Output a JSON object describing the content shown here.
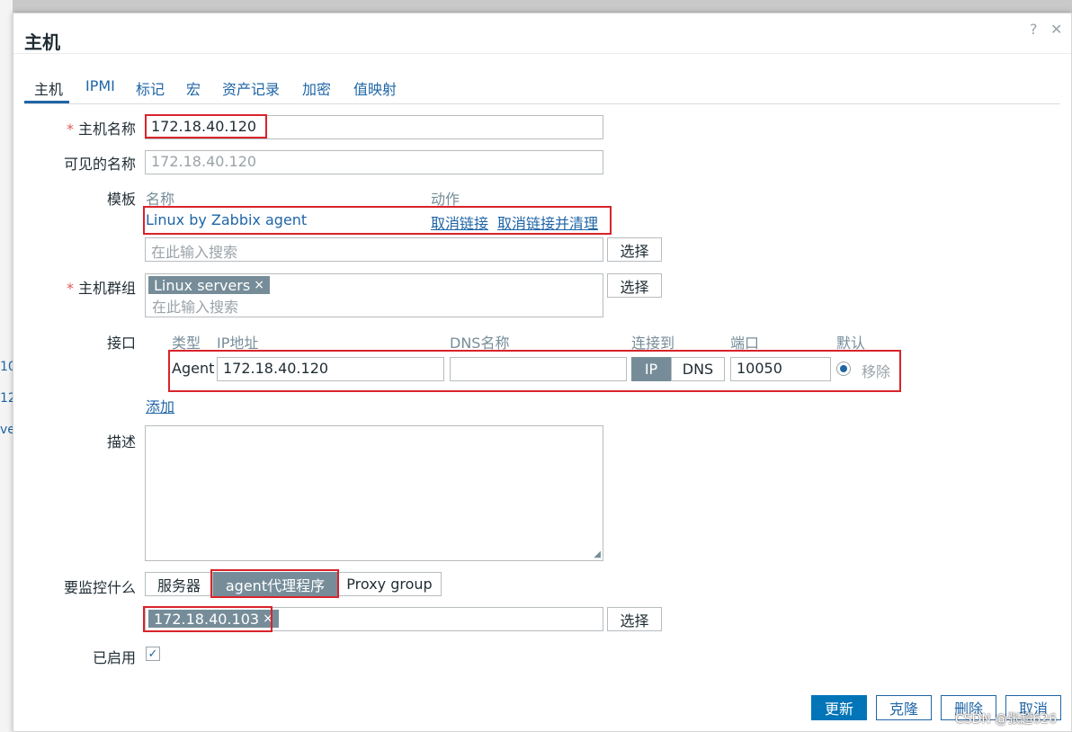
{
  "background": {
    "peek_lines": [
      "10",
      "12",
      "ve"
    ]
  },
  "dialog": {
    "title": "主机",
    "help_icon": "?",
    "close_icon": "✕"
  },
  "tabs": [
    {
      "label": "主机",
      "active": true
    },
    {
      "label": "IPMI",
      "active": false
    },
    {
      "label": "标记",
      "active": false
    },
    {
      "label": "宏",
      "active": false
    },
    {
      "label": "资产记录",
      "active": false
    },
    {
      "label": "加密",
      "active": false
    },
    {
      "label": "值映射",
      "active": false
    }
  ],
  "form": {
    "host_name": {
      "required_mark": "*",
      "label": "主机名称",
      "value": "172.18.40.120"
    },
    "visible_name": {
      "label": "可见的名称",
      "placeholder": "172.18.40.120"
    },
    "templates": {
      "label": "模板",
      "col_name": "名称",
      "col_action": "动作",
      "rows": [
        {
          "name": "Linux by Zabbix agent",
          "unlink": "取消链接",
          "unlink_clear": "取消链接并清理"
        }
      ],
      "search_placeholder": "在此输入搜索",
      "select_button": "选择"
    },
    "host_groups": {
      "required_mark": "*",
      "label": "主机群组",
      "tags": [
        {
          "text": "Linux servers",
          "remove": "×"
        }
      ],
      "search_placeholder": "在此输入搜索",
      "select_button": "选择"
    },
    "interfaces": {
      "label": "接口",
      "col_type": "类型",
      "col_ip": "IP地址",
      "col_dns": "DNS名称",
      "col_connect": "连接到",
      "col_port": "端口",
      "col_default": "默认",
      "rows": [
        {
          "type": "Agent",
          "ip": "172.18.40.120",
          "dns": "",
          "connect_ip": "IP",
          "connect_dns": "DNS",
          "connect_selected": "IP",
          "port": "10050",
          "default": true,
          "remove": "移除"
        }
      ],
      "add_link": "添加"
    },
    "description": {
      "label": "描述",
      "value": ""
    },
    "monitored_by": {
      "label": "要监控什么",
      "options": [
        "服务器",
        "agent代理程序",
        "Proxy group"
      ],
      "selected": "agent代理程序",
      "tags": [
        {
          "text": "172.18.40.103",
          "remove": "×"
        }
      ],
      "select_button": "选择"
    },
    "enabled": {
      "label": "已启用",
      "checked": true,
      "check_mark": "✓"
    }
  },
  "footer": {
    "update": "更新",
    "clone": "克隆",
    "delete": "删除",
    "cancel": "取消"
  },
  "watermark": "CSDN @张超626",
  "colors": {
    "link": "#1f65a6",
    "primary_button": "#0275b8",
    "tag_bg": "#768d99",
    "annotation_red": "#d9232a",
    "required": "#e45959"
  }
}
